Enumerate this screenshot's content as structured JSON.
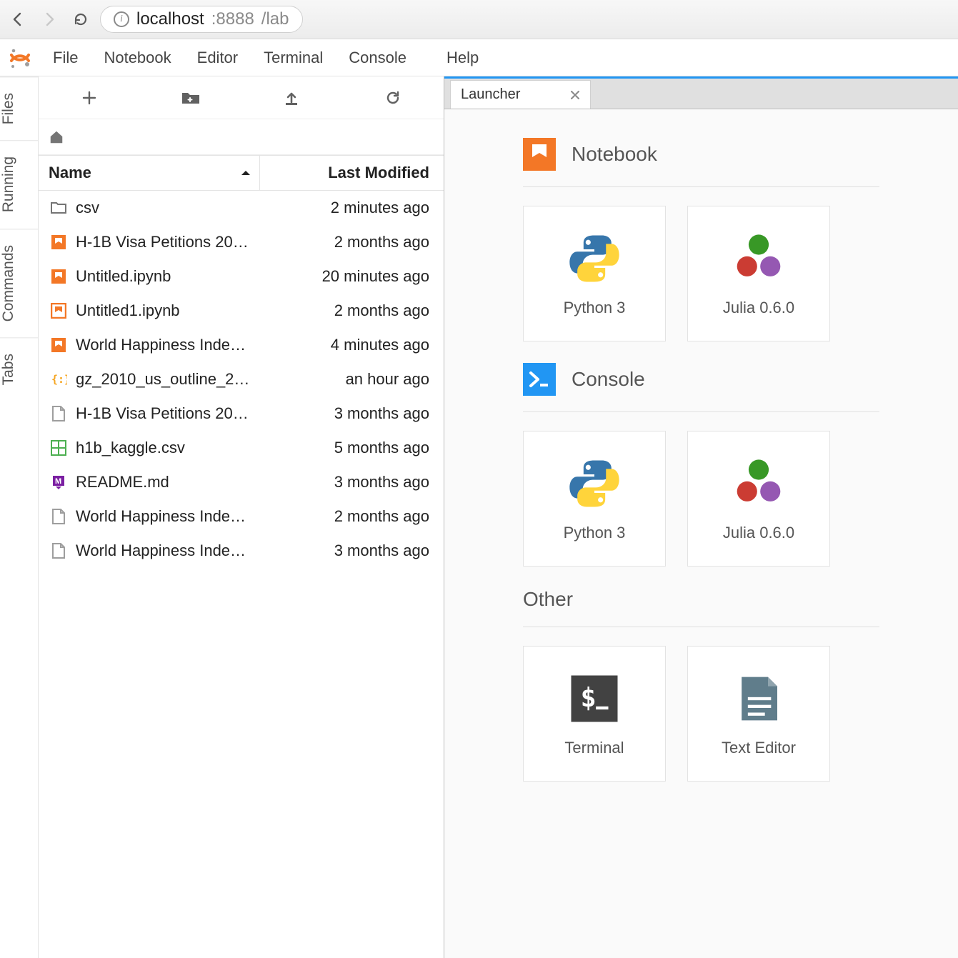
{
  "browser": {
    "url_host": "localhost",
    "url_port": ":8888",
    "url_path": "/lab"
  },
  "menubar": {
    "items": [
      "File",
      "Notebook",
      "Editor",
      "Terminal",
      "Console",
      "Help"
    ]
  },
  "side_tabs": [
    "Files",
    "Running",
    "Commands",
    "Tabs"
  ],
  "filebrowser": {
    "columns": {
      "name": "Name",
      "modified": "Last Modified"
    },
    "rows": [
      {
        "icon": "folder",
        "name": "csv",
        "modified": "2 minutes ago"
      },
      {
        "icon": "notebook",
        "name": "H-1B Visa Petitions 20…",
        "modified": "2 months ago"
      },
      {
        "icon": "notebook",
        "name": "Untitled.ipynb",
        "modified": "20 minutes ago"
      },
      {
        "icon": "notebook-running",
        "name": "Untitled1.ipynb",
        "modified": "2 months ago"
      },
      {
        "icon": "notebook",
        "name": "World Happiness Inde…",
        "modified": "4 minutes ago"
      },
      {
        "icon": "json",
        "name": "gz_2010_us_outline_2…",
        "modified": "an hour ago"
      },
      {
        "icon": "file",
        "name": "H-1B Visa Petitions 20…",
        "modified": "3 months ago"
      },
      {
        "icon": "csv",
        "name": "h1b_kaggle.csv",
        "modified": "5 months ago"
      },
      {
        "icon": "markdown",
        "name": "README.md",
        "modified": "3 months ago"
      },
      {
        "icon": "file",
        "name": "World Happiness Inde…",
        "modified": "2 months ago"
      },
      {
        "icon": "file",
        "name": "World Happiness Inde…",
        "modified": "3 months ago"
      }
    ]
  },
  "tab": {
    "title": "Launcher"
  },
  "launcher": {
    "sections": [
      {
        "title": "Notebook",
        "icon": "notebook-orange",
        "cards": [
          {
            "label": "Python 3",
            "icon": "python"
          },
          {
            "label": "Julia 0.6.0",
            "icon": "julia"
          }
        ]
      },
      {
        "title": "Console",
        "icon": "console-blue",
        "cards": [
          {
            "label": "Python 3",
            "icon": "python"
          },
          {
            "label": "Julia 0.6.0",
            "icon": "julia"
          }
        ]
      },
      {
        "title": "Other",
        "icon": "none",
        "cards": [
          {
            "label": "Terminal",
            "icon": "terminal"
          },
          {
            "label": "Text Editor",
            "icon": "texteditor"
          }
        ]
      }
    ]
  }
}
